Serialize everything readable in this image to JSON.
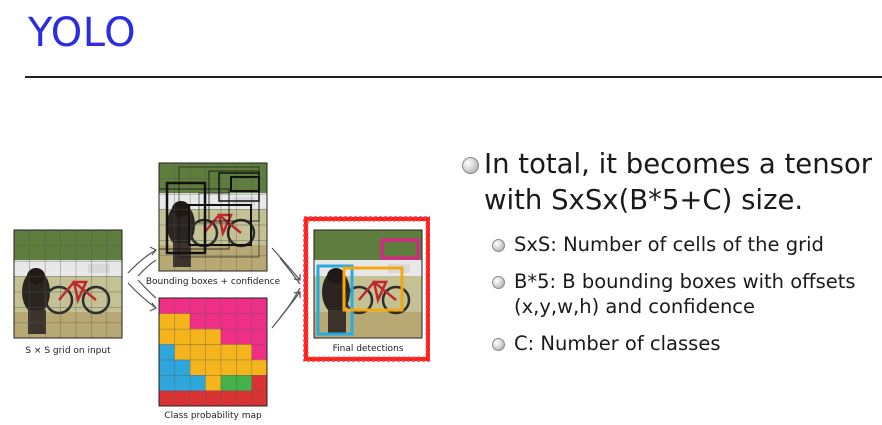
{
  "slide": {
    "title": "YOLO"
  },
  "figure": {
    "captions": {
      "grid": "S × S grid on input",
      "boxes": "Bounding boxes + confidence",
      "classmap": "Class probability map",
      "final": "Final detections"
    },
    "class_map_colors": [
      "#ef2f86",
      "#f5b41c",
      "#2ea6dc",
      "#46b04a",
      "#d83232"
    ]
  },
  "bullets": {
    "main": [
      "In total, it becomes a tensor",
      "with SxSx(B*5+C) size."
    ],
    "sub": [
      {
        "lines": [
          "SxS: Number of cells of the grid"
        ]
      },
      {
        "lines": [
          "B*5: B bounding boxes with offsets",
          "(x,y,w,h) and confidence"
        ]
      },
      {
        "lines": [
          "C: Number of classes"
        ]
      }
    ]
  }
}
